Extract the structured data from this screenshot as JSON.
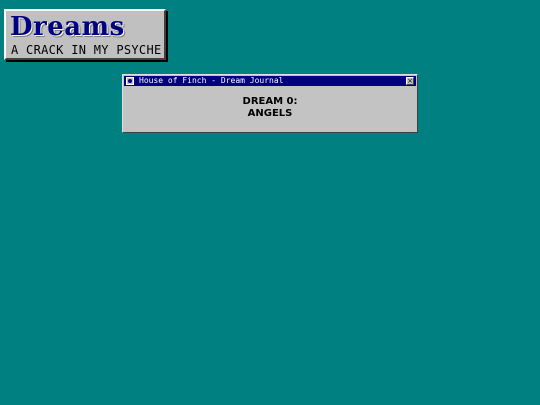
{
  "header": {
    "title": "Dreams",
    "subtitle": "A CRACK IN MY PSYCHE"
  },
  "window": {
    "title": "House of Finch - Dream Journal",
    "icon": "app-icon",
    "close_glyph": "×",
    "dream_number": "DREAM 0:",
    "dream_title": "ANGELS"
  },
  "colors": {
    "desktop": "#008080",
    "titlebar": "#000080",
    "chrome": "#c3c3c3"
  }
}
